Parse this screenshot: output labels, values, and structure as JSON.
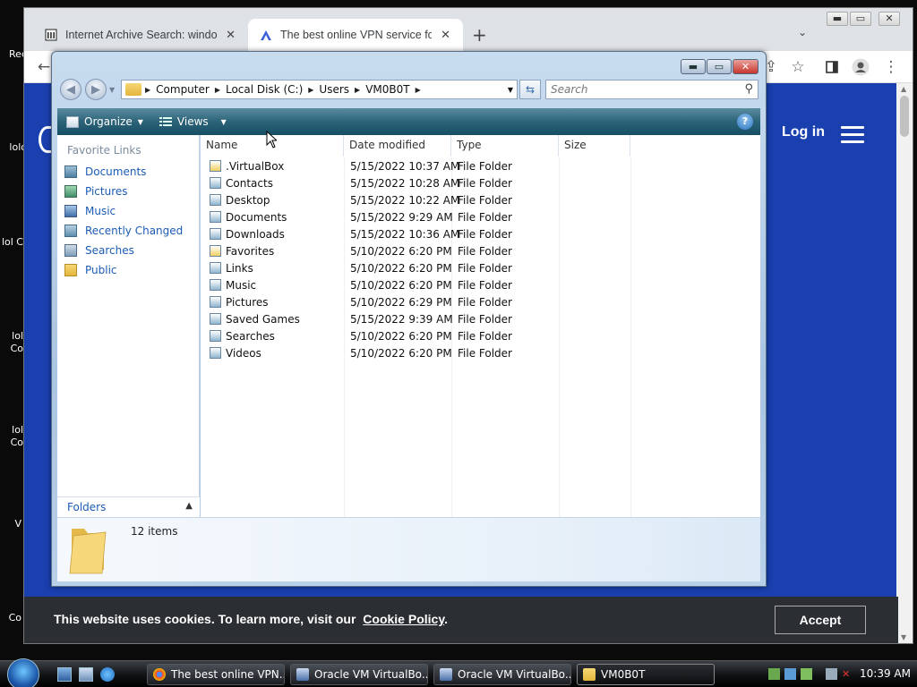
{
  "desktop": {
    "icons": [
      {
        "name": "desktop-icon-recycle",
        "label": "Rec"
      },
      {
        "name": "desktop-icon-1",
        "label": "lolo"
      },
      {
        "name": "desktop-icon-2",
        "label": "lol C"
      },
      {
        "name": "desktop-icon-3",
        "label": "lol Co"
      },
      {
        "name": "desktop-icon-4",
        "label": "lol Co"
      },
      {
        "name": "desktop-icon-5",
        "label": "V"
      },
      {
        "name": "desktop-icon-6",
        "label": "Co"
      }
    ]
  },
  "browser": {
    "tabs": [
      {
        "title": "Internet Archive Search: windows",
        "icon": "archive-icon"
      },
      {
        "title": "The best online VPN service for s",
        "icon": "vpn-icon"
      }
    ],
    "page": {
      "login": "Log in",
      "cookie_text": "This website uses cookies. To learn more, visit our",
      "cookie_link": "Cookie Policy",
      "cookie_end": ".",
      "accept": "Accept"
    }
  },
  "explorer": {
    "breadcrumb": [
      "Computer",
      "Local Disk (C:)",
      "Users",
      "VM0B0T"
    ],
    "search_placeholder": "Search",
    "toolbar": {
      "organize": "Organize",
      "views": "Views"
    },
    "nav": {
      "header": "Favorite Links",
      "links": [
        "Documents",
        "Pictures",
        "Music",
        "Recently Changed",
        "Searches",
        "Public"
      ],
      "folders": "Folders"
    },
    "columns": [
      "Name",
      "Date modified",
      "Type",
      "Size"
    ],
    "files": [
      {
        "name": ".VirtualBox",
        "date": "5/15/2022 10:37 AM",
        "type": "File Folder"
      },
      {
        "name": "Contacts",
        "date": "5/15/2022 10:28 AM",
        "type": "File Folder"
      },
      {
        "name": "Desktop",
        "date": "5/15/2022 10:22 AM",
        "type": "File Folder"
      },
      {
        "name": "Documents",
        "date": "5/15/2022 9:29 AM",
        "type": "File Folder"
      },
      {
        "name": "Downloads",
        "date": "5/15/2022 10:36 AM",
        "type": "File Folder"
      },
      {
        "name": "Favorites",
        "date": "5/10/2022 6:20 PM",
        "type": "File Folder"
      },
      {
        "name": "Links",
        "date": "5/10/2022 6:20 PM",
        "type": "File Folder"
      },
      {
        "name": "Music",
        "date": "5/10/2022 6:20 PM",
        "type": "File Folder"
      },
      {
        "name": "Pictures",
        "date": "5/10/2022 6:29 PM",
        "type": "File Folder"
      },
      {
        "name": "Saved Games",
        "date": "5/15/2022 9:39 AM",
        "type": "File Folder"
      },
      {
        "name": "Searches",
        "date": "5/10/2022 6:20 PM",
        "type": "File Folder"
      },
      {
        "name": "Videos",
        "date": "5/10/2022 6:20 PM",
        "type": "File Folder"
      }
    ],
    "item_count": "12 items"
  },
  "taskbar": {
    "buttons": [
      {
        "label": "The best online VPN...",
        "icon": "chrome-icon"
      },
      {
        "label": "Oracle VM VirtualBo...",
        "icon": "virtualbox-icon"
      },
      {
        "label": "Oracle VM VirtualBo...",
        "icon": "virtualbox-icon"
      },
      {
        "label": "VM0B0T",
        "icon": "folder-icon"
      }
    ],
    "clock": "10:39 AM"
  },
  "colors": {
    "page_blue": "#1a3fae",
    "link_blue": "#1b5bb5",
    "cmdbar_teal": "#2c6378",
    "cookie_bar": "#2b2e33"
  }
}
